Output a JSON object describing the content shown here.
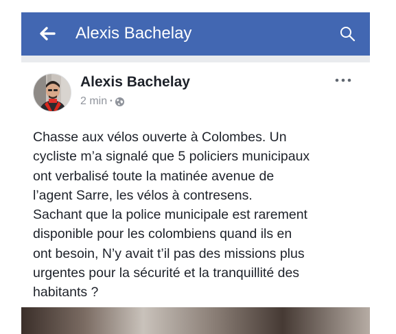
{
  "header": {
    "title": "Alexis Bachelay",
    "back_icon": "arrow-left-icon",
    "search_icon": "search-icon",
    "background_color": "#4267b2"
  },
  "post": {
    "author": "Alexis Bachelay",
    "time": "2 min",
    "separator": "•",
    "privacy_icon": "globe-icon",
    "more_icon": "more-horizontal-icon",
    "text_lines": [
      "Chasse aux vélos ouverte à Colombes. Un",
      "cycliste m’a signalé que 5 policiers municipaux",
      "ont verbalisé toute la matinée avenue de",
      "l’agent Sarre, les vélos à contresens.",
      "Sachant que la police municipale est rarement",
      "disponible pour les colombiens quand ils en",
      "ont besoin, N’y avait t’il pas des missions plus",
      "urgentes pour la sécurité et la tranquillité des",
      "habitants ?"
    ]
  }
}
